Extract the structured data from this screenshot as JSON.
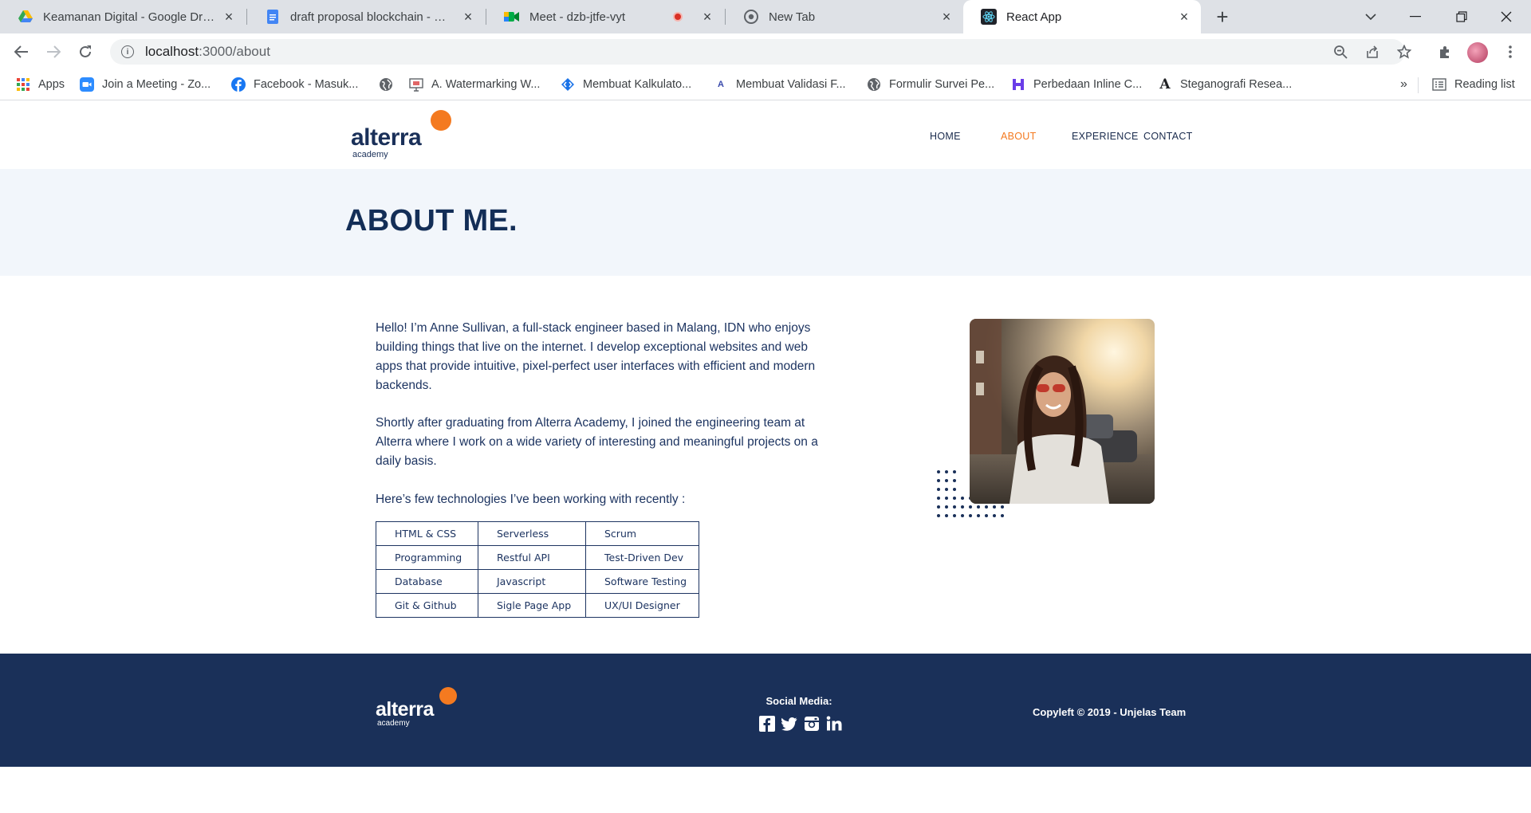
{
  "browser": {
    "tabs": [
      {
        "title": "Keamanan Digital - Google Drive",
        "icon": "google-drive-icon"
      },
      {
        "title": "draft proposal blockchain - Google Docs",
        "icon": "google-docs-icon"
      },
      {
        "title": "Meet - dzb-jtfe-vyt",
        "icon": "google-meet-icon",
        "recording": true
      },
      {
        "title": "New Tab",
        "icon": "chrome-icon"
      },
      {
        "title": "React App",
        "icon": "react-icon",
        "active": true
      }
    ],
    "url_host": "localhost",
    "url_path": ":3000/about",
    "bookmarks": [
      {
        "label": "Apps",
        "icon": "apps-grid-icon"
      },
      {
        "label": "Join a Meeting - Zo...",
        "icon": "zoom-icon"
      },
      {
        "label": "Facebook - Masuk...",
        "icon": "facebook-icon"
      },
      {
        "label": "",
        "icon": "globe-icon"
      },
      {
        "label": "A. Watermarking W...",
        "icon": "presentation-icon"
      },
      {
        "label": "Membuat Kalkulato...",
        "icon": "diamond-arrows-icon"
      },
      {
        "label": "Membuat Validasi F...",
        "icon": "letter-a-icon"
      },
      {
        "label": "Formulir Survei Pe...",
        "icon": "globe-icon"
      },
      {
        "label": "Perbedaan Inline C...",
        "icon": "h-logo-icon"
      },
      {
        "label": "Steganografi Resea...",
        "icon": "serif-a-icon"
      }
    ],
    "bookmarks_overflow": "»",
    "reading_list": "Reading list"
  },
  "site": {
    "logo_word": "alterra",
    "logo_sub": "academy",
    "nav": [
      "HOME",
      "ABOUT",
      "EXPERIENCE",
      "CONTACT"
    ],
    "active_nav": "ABOUT",
    "hero_title": "ABOUT ME.",
    "paragraphs": [
      "Hello! I’m Anne Sullivan, a full-stack engineer based in Malang, IDN who enjoys building things that live on the internet. I develop exceptional websites and web apps that provide intuitive, pixel-perfect user interfaces with efficient and modern backends.",
      "Shortly after graduating from Alterra Academy, I joined the engineering team at Alterra where I work on a wide variety of interesting and meaningful projects on a daily basis.",
      "Here’s few technologies I’ve been working with recently :"
    ],
    "tech_table": [
      [
        "HTML & CSS",
        "Serverless",
        "Scrum"
      ],
      [
        "Programming",
        "Restful API",
        "Test-Driven Dev"
      ],
      [
        "Database",
        "Javascript",
        "Software Testing"
      ],
      [
        "Git & Github",
        "Sigle Page App",
        "UX/UI Designer"
      ]
    ],
    "footer": {
      "social_title": "Social Media:",
      "social_icons": [
        "facebook-icon",
        "twitter-icon",
        "instagram-icon",
        "linkedin-icon"
      ],
      "copyright": "Copyleft © 2019 - Unjelas Team"
    },
    "colors": {
      "navy": "#1a3059",
      "accent": "#f47a20",
      "hero_bg": "#f2f6fb"
    }
  }
}
